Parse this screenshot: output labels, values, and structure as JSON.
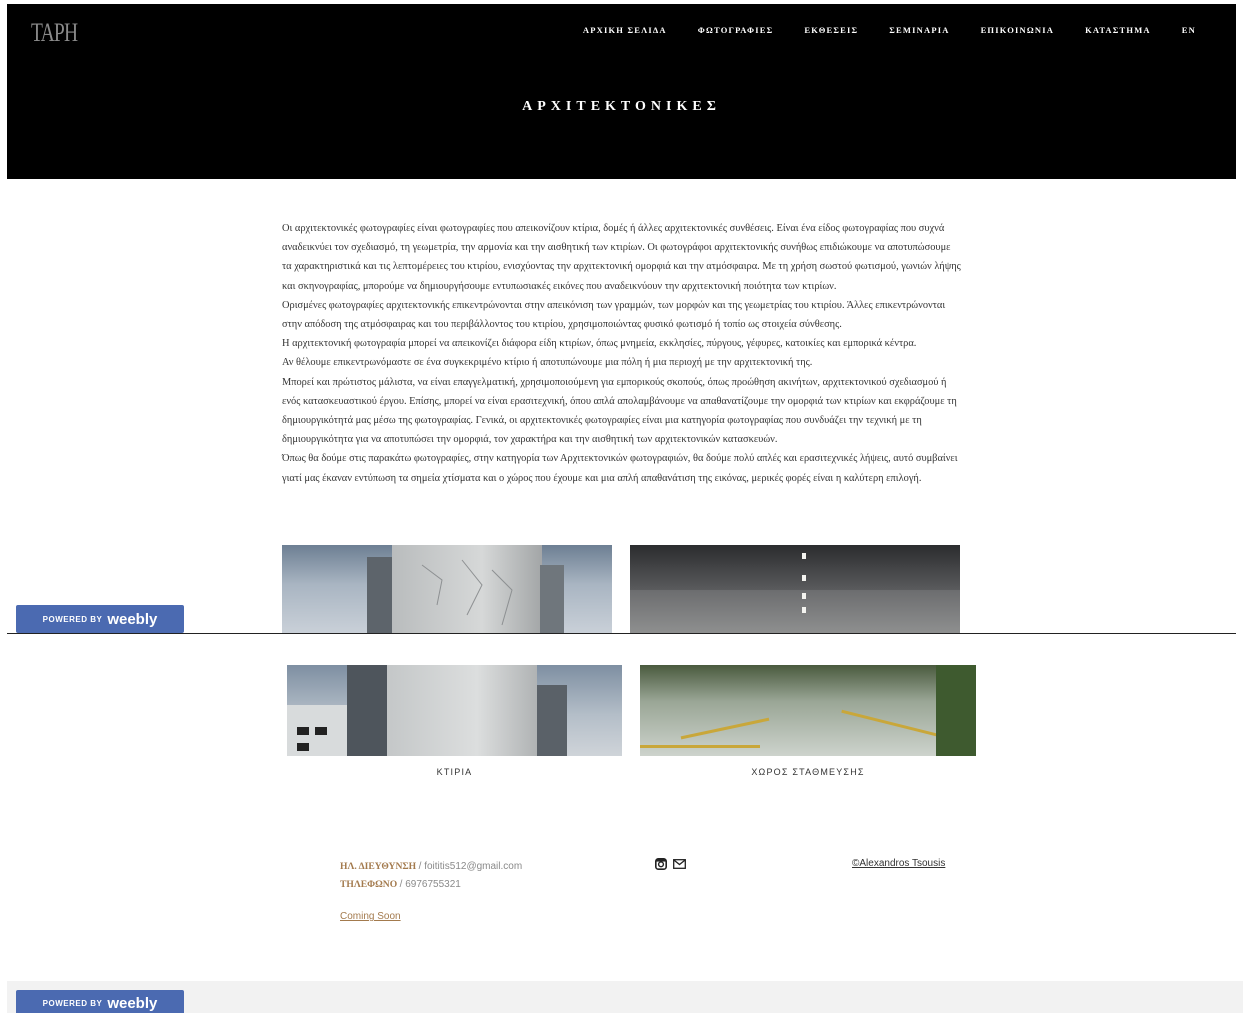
{
  "header": {
    "logo_text": "TAPH",
    "page_title": "ΑΡΧΙΤΕΚΤΟΝΙΚΕΣ",
    "nav": [
      {
        "label": "ΑΡΧΙΚΗ ΣΕΛΙΔΑ"
      },
      {
        "label": "ΦΩΤΟΓΡΑΦΙΕΣ"
      },
      {
        "label": "ΕΚΘΕΣΕΙΣ"
      },
      {
        "label": "ΣΕΜΙΝΑΡΙΑ"
      },
      {
        "label": "ΕΠΙΚΟΙΝΩΝΙΑ"
      },
      {
        "label": "ΚΑΤΑΣΤΗΜΑ"
      },
      {
        "label": "EN"
      }
    ]
  },
  "content": {
    "paragraphs": [
      "Οι αρχιτεκτονικές φωτογραφίες είναι φωτογραφίες που απεικονίζουν κτίρια, δομές ή άλλες αρχιτεκτονικές συνθέσεις. Είναι ένα είδος φωτογραφίας που συχνά αναδεικνύει τον σχεδιασμό, τη γεωμετρία, την αρμονία και την αισθητική των κτιρίων. Οι φωτογράφοι αρχιτεκτονικής συνήθως επιδιώκουμε να αποτυπώσουμε τα χαρακτηριστικά και τις λεπτομέρειες του κτιρίου, ενισχύοντας την αρχιτεκτονική ομορφιά και την ατμόσφαιρα. Με τη χρήση σωστού φωτισμού, γωνιών λήψης και σκηνογραφίας, μπορούμε να δημιουργήσουμε εντυπωσιακές εικόνες που αναδεικνύουν την αρχιτεκτονική ποιότητα των κτιρίων.",
      "Ορισμένες φωτογραφίες αρχιτεκτονικής επικεντρώνονται στην απεικόνιση των γραμμών, των μορφών και της γεωμετρίας του κτιρίου. Άλλες επικεντρώνονται στην απόδοση της ατμόσφαιρας και του περιβάλλοντος του κτιρίου, χρησιμοποιώντας φυσικό φωτισμό ή τοπίο ως στοιχεία σύνθεσης.",
      "Η αρχιτεκτονική φωτογραφία μπορεί να απεικονίζει διάφορα είδη κτιρίων, όπως μνημεία, εκκλησίες, πύργους, γέφυρες, κατοικίες και εμπορικά κέντρα.",
      "Αν θέλουμε επικεντρωνόμαστε σε ένα συγκεκριμένο κτίριο ή αποτυπώνουμε μια πόλη ή μια περιοχή με την αρχιτεκτονική της.",
      "Μπορεί και πρώτιστος μάλιστα, να είναι επαγγελματική, χρησιμοποιούμενη για εμπορικούς σκοπούς, όπως προώθηση ακινήτων, αρχιτεκτονικού σχεδιασμού ή ενός κατασκευαστικού έργου. Επίσης, μπορεί να είναι ερασιτεχνική, όπου απλά απολαμβάνουμε να απαθανατίζουμε την ομορφιά των κτιρίων και εκφράζουμε τη δημιουργικότητά μας μέσω της φωτογραφίας. Γενικά, οι αρχιτεκτονικές φωτογραφίες είναι μια κατηγορία φωτογραφίας που συνδυάζει την τεχνική με τη δημιουργικότητα για να αποτυπώσει την ομορφιά, τον χαρακτήρα και την αισθητική των αρχιτεκτονικών κατασκευών.",
      "Όπως θα δούμε στις παρακάτω φωτογραφίες, στην κατηγορία των Αρχιτεκτονικών φωτογραφιών, θα δούμε πολύ απλές και ερασιτεχνικές λήψεις, αυτό συμβαίνει γιατί μας έκαναν εντύπωση τα σημεία χτίσματα και ο χώρος που έχουμε και μια απλή απαθανάτιση της εικόνας, μερικές φορές είναι η καλύτερη επιλογή."
    ]
  },
  "gallery": [
    {
      "caption": "ΚΤΙΡΙΑ"
    },
    {
      "caption": "ΧΩΡΟΣ ΣΤΑΘΜΕΥΣΗΣ"
    }
  ],
  "badge": {
    "powered_by": "POWERED BY",
    "brand": "weebly"
  },
  "footer": {
    "email_label": "ΗΛ. ΔΙΕΥΘΥΝΣΗ",
    "email_value": "/ foititis512@gmail.com",
    "phone_label": "ΤΗΛΕΦΩΝΟ",
    "phone_value": "/ 6976755321",
    "coming_soon": "Coming Soon",
    "copyright": "©Alexandros Tsousis",
    "icons": [
      "instagram-icon",
      "mail-icon"
    ]
  },
  "colors": {
    "accent": "#a37a4d",
    "badge": "#4b6ab1",
    "header_bg": "#000000"
  }
}
